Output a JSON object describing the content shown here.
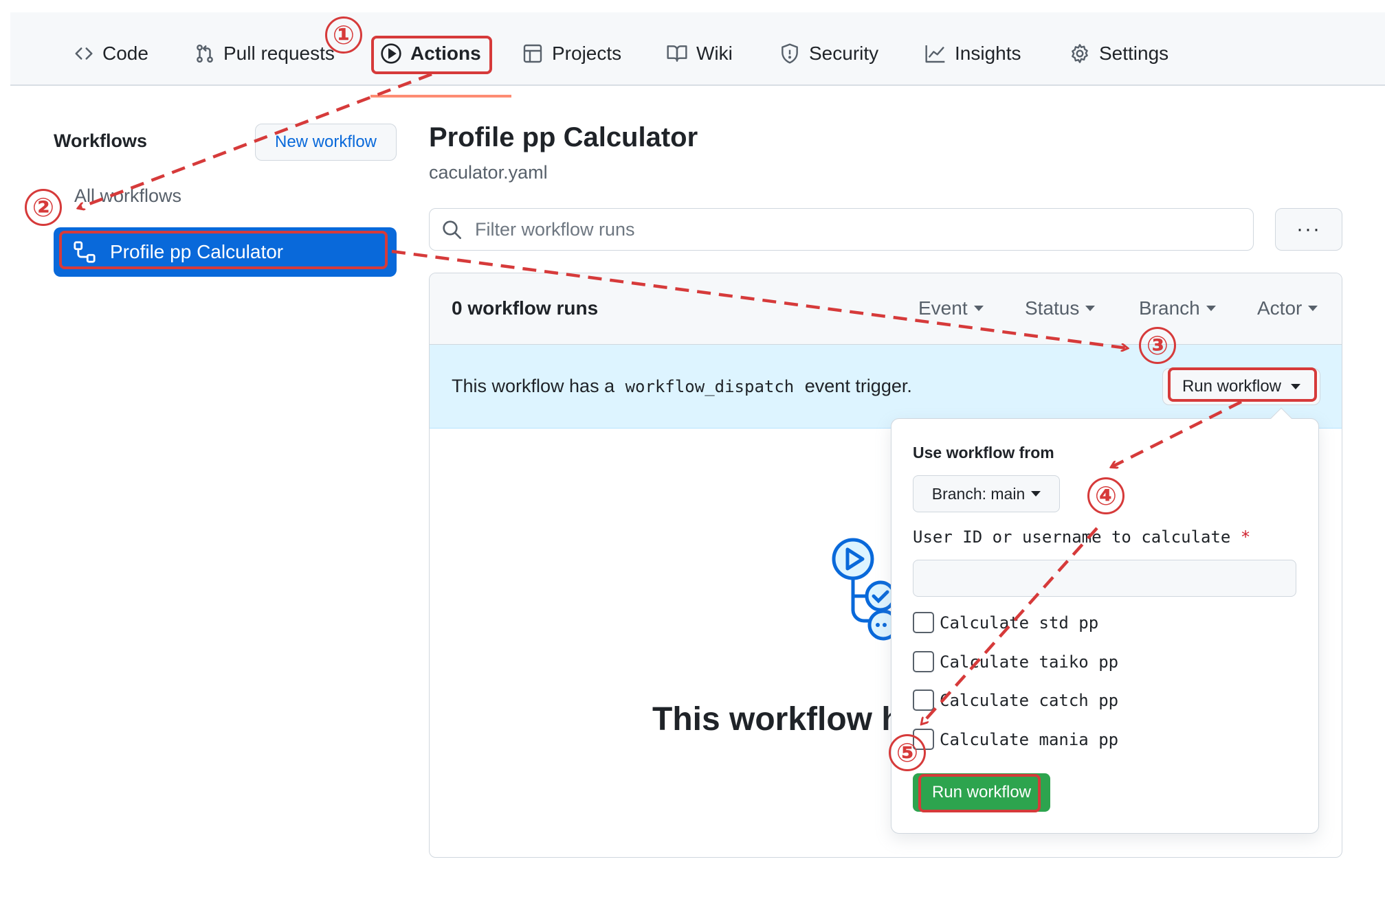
{
  "nav": {
    "tabs": [
      {
        "label": "Code",
        "icon": "code-icon"
      },
      {
        "label": "Pull requests",
        "icon": "pull-request-icon"
      },
      {
        "label": "Actions",
        "icon": "play-icon",
        "active": true
      },
      {
        "label": "Projects",
        "icon": "table-icon"
      },
      {
        "label": "Wiki",
        "icon": "book-icon"
      },
      {
        "label": "Security",
        "icon": "shield-icon"
      },
      {
        "label": "Insights",
        "icon": "graph-icon"
      },
      {
        "label": "Settings",
        "icon": "gear-icon"
      }
    ]
  },
  "sidebar": {
    "title": "Workflows",
    "new_workflow": "New workflow",
    "all_workflows": "All workflows",
    "selected": "Profile pp Calculator"
  },
  "main": {
    "title": "Profile pp Calculator",
    "file": "caculator.yaml",
    "filter_placeholder": "Filter workflow runs",
    "kebab": "···",
    "runs_count": "0 workflow runs",
    "filters": [
      "Event",
      "Status",
      "Branch",
      "Actor"
    ],
    "dispatch_prefix": "This workflow has a",
    "dispatch_code": "workflow_dispatch",
    "dispatch_suffix": "event trigger.",
    "run_workflow": "Run workflow",
    "empty_title": "This workflow h"
  },
  "popover": {
    "heading": "Use workflow from",
    "branch": "Branch: main",
    "field_label": "User ID or username to calculate",
    "required_mark": "*",
    "field_value": "",
    "checkboxes": [
      {
        "label": "Calculate std pp",
        "checked": false
      },
      {
        "label": "Calculate taiko pp",
        "checked": false
      },
      {
        "label": "Calculate catch pp",
        "checked": false
      },
      {
        "label": "Calculate mania pp",
        "checked": false
      }
    ],
    "submit": "Run workflow"
  },
  "annotations": {
    "steps": [
      "①",
      "②",
      "③",
      "④",
      "⑤"
    ]
  },
  "colors": {
    "accent_blue": "#0969da",
    "annotation_red": "#d63a3a",
    "run_green": "#2da44e",
    "dispatch_bg": "#ddf4ff",
    "active_tab_underline": "#fd8c73"
  }
}
